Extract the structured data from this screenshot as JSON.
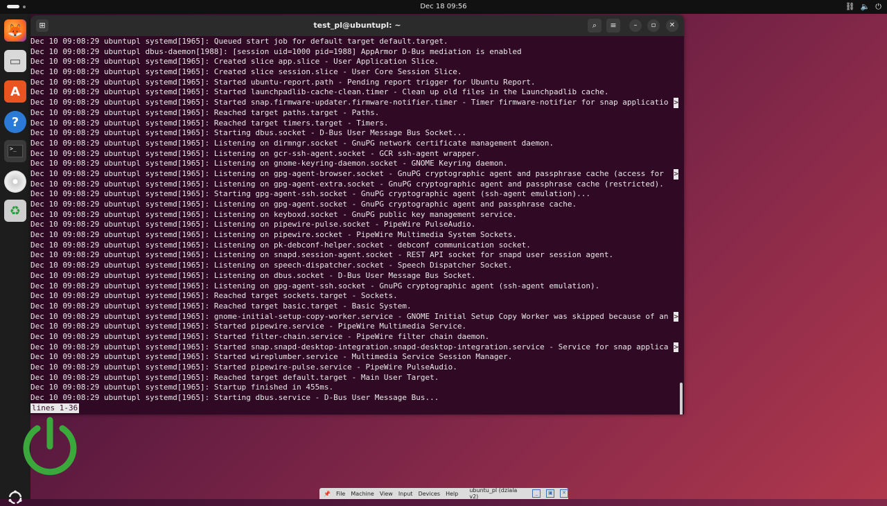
{
  "topbar": {
    "clock": "Dec 18  09:56",
    "tray_icons": [
      "network-icon",
      "volume-icon",
      "power-icon"
    ]
  },
  "dock": {
    "apps": [
      "firefox-icon",
      "files-icon",
      "app-center-icon",
      "help-icon",
      "terminal-icon",
      "disc-icon",
      "trash-icon"
    ]
  },
  "terminal": {
    "title": "test_pl@ubuntupl: ~",
    "lines": [
      "Dec 10 09:08:29 ubuntupl systemd[1965]: Queued start job for default target default.target.",
      "Dec 10 09:08:29 ubuntupl dbus-daemon[1988]: [session uid=1000 pid=1988] AppArmor D-Bus mediation is enabled",
      "Dec 10 09:08:29 ubuntupl systemd[1965]: Created slice app.slice - User Application Slice.",
      "Dec 10 09:08:29 ubuntupl systemd[1965]: Created slice session.slice - User Core Session Slice.",
      "Dec 10 09:08:29 ubuntupl systemd[1965]: Started ubuntu-report.path - Pending report trigger for Ubuntu Report.",
      "Dec 10 09:08:29 ubuntupl systemd[1965]: Started launchpadlib-cache-clean.timer - Clean up old files in the Launchpadlib cache.",
      "Dec 10 09:08:29 ubuntupl systemd[1965]: Started snap.firmware-updater.firmware-notifier.timer - Timer firmware-notifier for snap applicatio",
      "Dec 10 09:08:29 ubuntupl systemd[1965]: Reached target paths.target - Paths.",
      "Dec 10 09:08:29 ubuntupl systemd[1965]: Reached target timers.target - Timers.",
      "Dec 10 09:08:29 ubuntupl systemd[1965]: Starting dbus.socket - D-Bus User Message Bus Socket...",
      "Dec 10 09:08:29 ubuntupl systemd[1965]: Listening on dirmngr.socket - GnuPG network certificate management daemon.",
      "Dec 10 09:08:29 ubuntupl systemd[1965]: Listening on gcr-ssh-agent.socket - GCR ssh-agent wrapper.",
      "Dec 10 09:08:29 ubuntupl systemd[1965]: Listening on gnome-keyring-daemon.socket - GNOME Keyring daemon.",
      "Dec 10 09:08:29 ubuntupl systemd[1965]: Listening on gpg-agent-browser.socket - GnuPG cryptographic agent and passphrase cache (access for ",
      "Dec 10 09:08:29 ubuntupl systemd[1965]: Listening on gpg-agent-extra.socket - GnuPG cryptographic agent and passphrase cache (restricted).",
      "Dec 10 09:08:29 ubuntupl systemd[1965]: Starting gpg-agent-ssh.socket - GnuPG cryptographic agent (ssh-agent emulation)...",
      "Dec 10 09:08:29 ubuntupl systemd[1965]: Listening on gpg-agent.socket - GnuPG cryptographic agent and passphrase cache.",
      "Dec 10 09:08:29 ubuntupl systemd[1965]: Listening on keyboxd.socket - GnuPG public key management service.",
      "Dec 10 09:08:29 ubuntupl systemd[1965]: Listening on pipewire-pulse.socket - PipeWire PulseAudio.",
      "Dec 10 09:08:29 ubuntupl systemd[1965]: Listening on pipewire.socket - PipeWire Multimedia System Sockets.",
      "Dec 10 09:08:29 ubuntupl systemd[1965]: Listening on pk-debconf-helper.socket - debconf communication socket.",
      "Dec 10 09:08:29 ubuntupl systemd[1965]: Listening on snapd.session-agent.socket - REST API socket for snapd user session agent.",
      "Dec 10 09:08:29 ubuntupl systemd[1965]: Listening on speech-dispatcher.socket - Speech Dispatcher Socket.",
      "Dec 10 09:08:29 ubuntupl systemd[1965]: Listening on dbus.socket - D-Bus User Message Bus Socket.",
      "Dec 10 09:08:29 ubuntupl systemd[1965]: Listening on gpg-agent-ssh.socket - GnuPG cryptographic agent (ssh-agent emulation).",
      "Dec 10 09:08:29 ubuntupl systemd[1965]: Reached target sockets.target - Sockets.",
      "Dec 10 09:08:29 ubuntupl systemd[1965]: Reached target basic.target - Basic System.",
      "Dec 10 09:08:29 ubuntupl systemd[1965]: gnome-initial-setup-copy-worker.service - GNOME Initial Setup Copy Worker was skipped because of an",
      "Dec 10 09:08:29 ubuntupl systemd[1965]: Started pipewire.service - PipeWire Multimedia Service.",
      "Dec 10 09:08:29 ubuntupl systemd[1965]: Started filter-chain.service - PipeWire filter chain daemon.",
      "Dec 10 09:08:29 ubuntupl systemd[1965]: Started snap.snapd-desktop-integration.snapd-desktop-integration.service - Service for snap applica",
      "Dec 10 09:08:29 ubuntupl systemd[1965]: Started wireplumber.service - Multimedia Service Session Manager.",
      "Dec 10 09:08:29 ubuntupl systemd[1965]: Started pipewire-pulse.service - PipeWire PulseAudio.",
      "Dec 10 09:08:29 ubuntupl systemd[1965]: Reached target default.target - Main User Target.",
      "Dec 10 09:08:29 ubuntupl systemd[1965]: Startup finished in 455ms.",
      "Dec 10 09:08:29 ubuntupl systemd[1965]: Starting dbus.service - D-Bus User Message Bus..."
    ],
    "truncated_marker": ">",
    "truncated_lines": [
      6,
      13,
      27,
      30
    ],
    "status": "lines 1-36"
  },
  "vmbar": {
    "menus": [
      "File",
      "Machine",
      "View",
      "Input",
      "Devices",
      "Help"
    ],
    "title": "ubuntu_pl (dziala v2)"
  },
  "colors": {
    "terminal_bg": "#300a24",
    "power_overlay": "#3aa83a"
  }
}
